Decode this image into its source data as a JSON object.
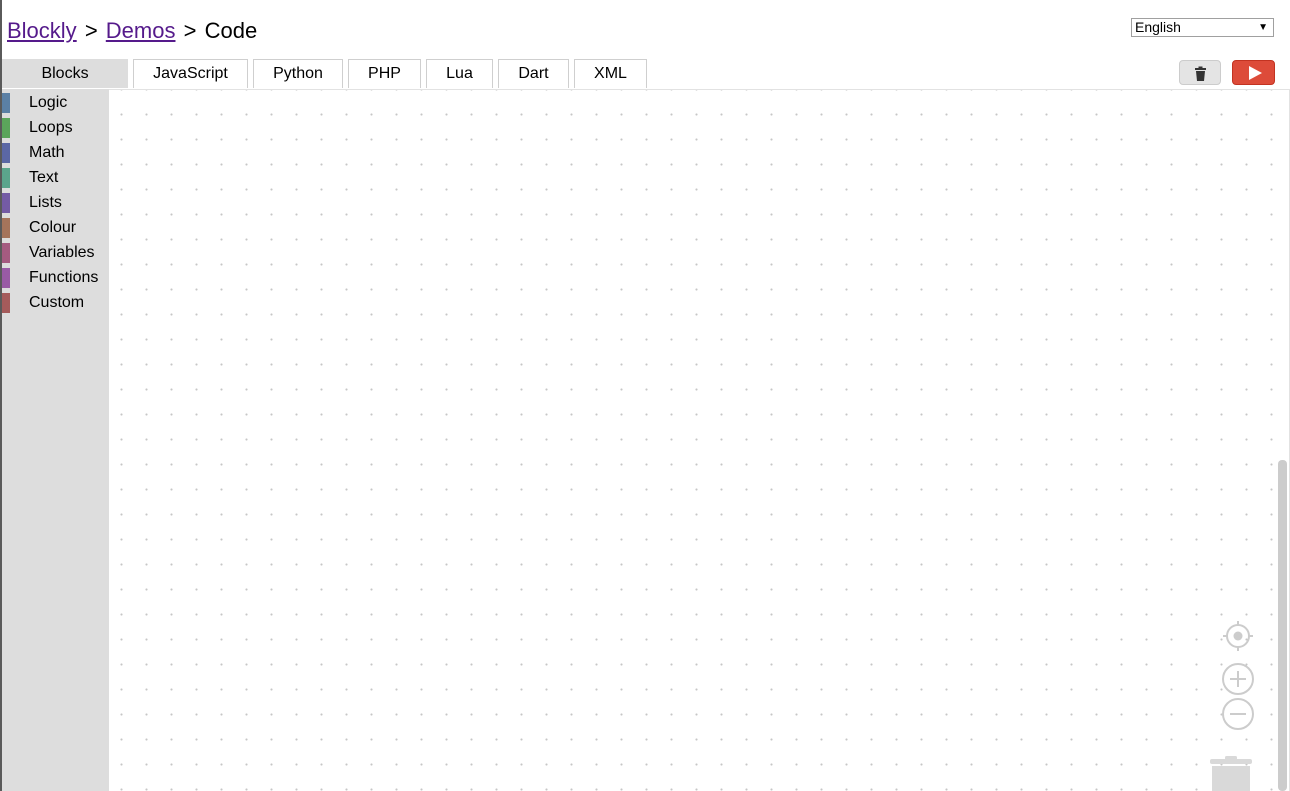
{
  "breadcrumb": {
    "links": [
      "Blockly",
      "Demos"
    ],
    "separator": ">",
    "current": "Code"
  },
  "language": {
    "selected": "English"
  },
  "tabs": [
    {
      "label": "Blocks",
      "selected": true
    },
    {
      "label": "JavaScript",
      "selected": false
    },
    {
      "label": "Python",
      "selected": false
    },
    {
      "label": "PHP",
      "selected": false
    },
    {
      "label": "Lua",
      "selected": false
    },
    {
      "label": "Dart",
      "selected": false
    },
    {
      "label": "XML",
      "selected": false
    }
  ],
  "toolbar": {
    "trash_icon": "trash-icon",
    "run_icon": "play-icon",
    "run_color": "#dd4b39"
  },
  "toolbox": {
    "categories": [
      {
        "label": "Logic",
        "color": "#5b80a5"
      },
      {
        "label": "Loops",
        "color": "#5ba55b"
      },
      {
        "label": "Math",
        "color": "#5b67a5"
      },
      {
        "label": "Text",
        "color": "#5ba58c"
      },
      {
        "label": "Lists",
        "color": "#745ba5"
      },
      {
        "label": "Colour",
        "color": "#a5745b"
      },
      {
        "label": "Variables",
        "color": "#a55b80"
      },
      {
        "label": "Functions",
        "color": "#995ba5"
      },
      {
        "label": "Custom",
        "color": "#a55b5b"
      }
    ]
  },
  "workspace": {
    "controls": [
      "recenter-icon",
      "zoom-in-icon",
      "zoom-out-icon",
      "trashcan-icon"
    ]
  }
}
